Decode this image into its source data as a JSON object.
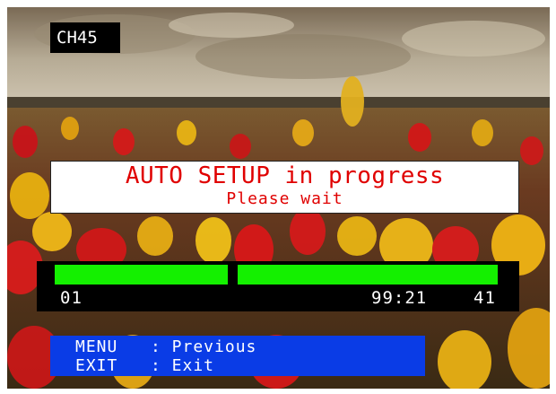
{
  "channel": {
    "label": "CH45"
  },
  "message": {
    "title": "AUTO SETUP in progress",
    "subtitle": "Please wait"
  },
  "progress": {
    "start_label": "01",
    "time": "99:21",
    "channel_number": "41",
    "bar_colour": "#14f000"
  },
  "menu": {
    "items": [
      {
        "key": "MENU",
        "action": ": Previous"
      },
      {
        "key": "EXIT",
        "action": ": Exit"
      }
    ]
  },
  "background": {
    "subject": "tulip field under cloudy sky"
  }
}
